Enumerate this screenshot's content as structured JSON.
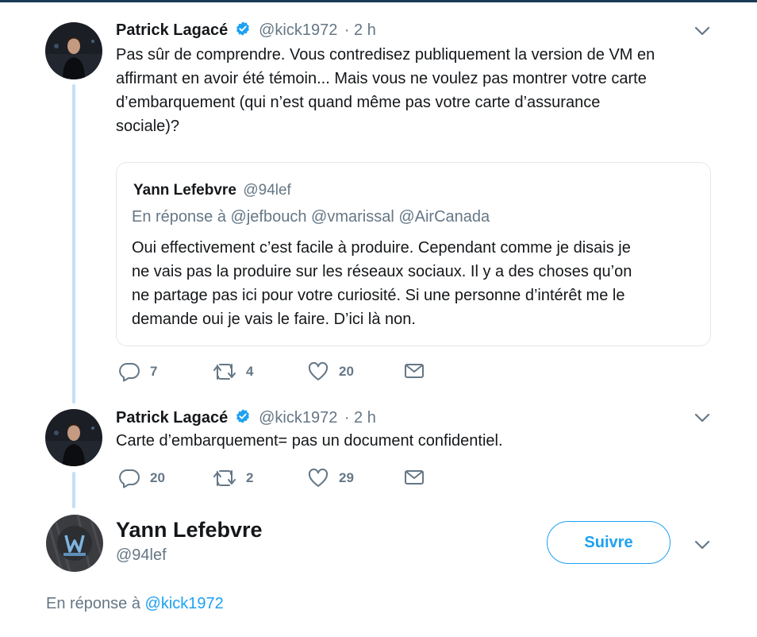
{
  "tweets": [
    {
      "author": "Patrick Lagacé",
      "handle": "@kick1972",
      "time": "· 2 h",
      "text_lines": [
        "Pas sûr de comprendre. Vous contredisez publiquement la version de VM en",
        "affirmant en avoir été témoin... Mais vous ne voulez pas montrer votre carte",
        "d’embarquement  (qui n’est quand même pas votre carte d’assurance",
        "sociale)?"
      ],
      "quote": {
        "author": "Yann Lefebvre",
        "handle": "@94lef",
        "reply_prefix": "En réponse à",
        "reply_handles": "@jefbouch @vmarissal @AirCanada",
        "text_lines": [
          "Oui effectivement c’est facile à produire. Cependant comme je disais je",
          "ne vais pas la produire sur les réseaux sociaux. Il y a des choses qu’on",
          "ne partage pas ici pour votre curiosité. Si une personne d’intérêt me le",
          "demande oui je vais le faire. D’ici là non."
        ]
      },
      "replies": "7",
      "retweets": "4",
      "likes": "20"
    },
    {
      "author": "Patrick Lagacé",
      "handle": "@kick1972",
      "time": "· 2 h",
      "text_lines": [
        "Carte d’embarquement= pas un document confidentiel."
      ],
      "replies": "20",
      "retweets": "2",
      "likes": "29"
    }
  ],
  "main_tweet": {
    "author": "Yann Lefebvre",
    "handle": "@94lef",
    "follow_label": "Suivre",
    "reply_prefix": "En réponse à",
    "reply_handle": "@kick1972"
  },
  "colors": {
    "accent": "#1da1f2",
    "secondary_text": "#657786",
    "thread_line": "#c4e0f5"
  },
  "icons": [
    "verified-badge-icon",
    "chevron-down-icon",
    "reply-icon",
    "retweet-icon",
    "like-icon",
    "message-icon"
  ]
}
